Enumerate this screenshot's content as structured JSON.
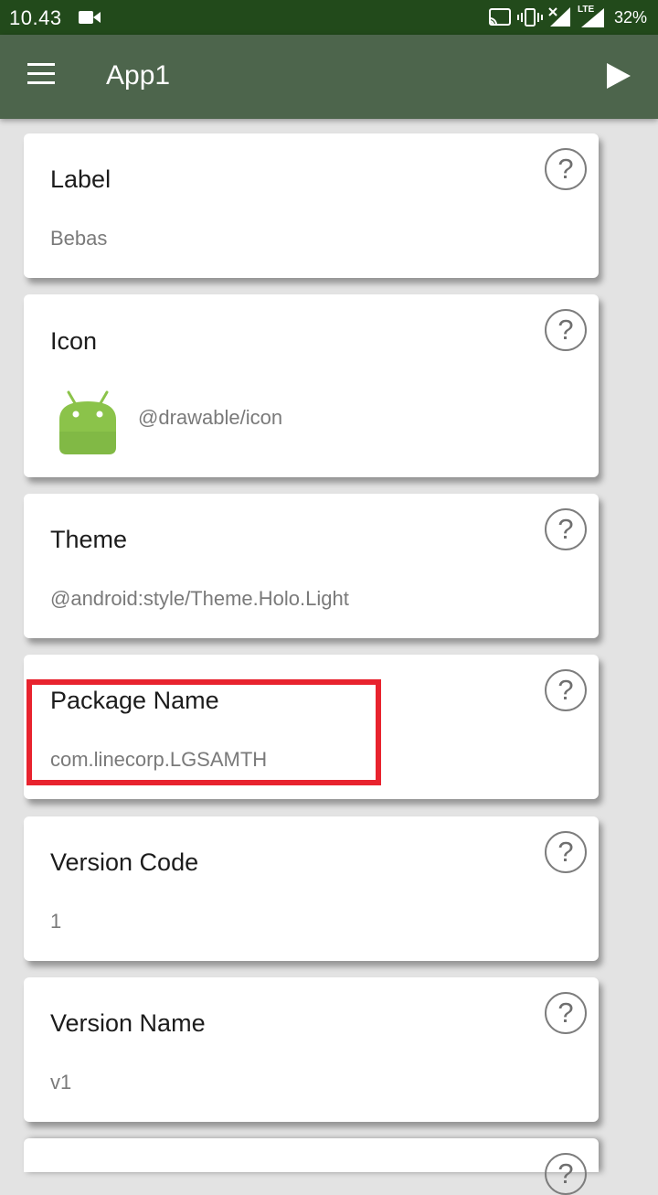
{
  "status_bar": {
    "time": "10.43",
    "network": "LTE",
    "battery": "32%"
  },
  "app_bar": {
    "title": "App1",
    "menu_icon": "hamburger-menu-icon",
    "run_icon": "play-icon"
  },
  "colors": {
    "status_bar": "#224a1b",
    "app_bar": "#4d654c",
    "highlight": "#e8232e",
    "android_green": "#8bc34a"
  },
  "cards": [
    {
      "label": "Label",
      "value": "Bebas",
      "help": "?"
    },
    {
      "label": "Icon",
      "value": "@drawable/icon",
      "help": "?"
    },
    {
      "label": "Theme",
      "value": "@android:style/Theme.Holo.Light",
      "help": "?"
    },
    {
      "label": "Package Name",
      "value": "com.linecorp.LGSAMTH",
      "help": "?"
    },
    {
      "label": "Version Code",
      "value": "1",
      "help": "?"
    },
    {
      "label": "Version Name",
      "value": "v1",
      "help": "?"
    },
    {
      "help": "?"
    }
  ]
}
